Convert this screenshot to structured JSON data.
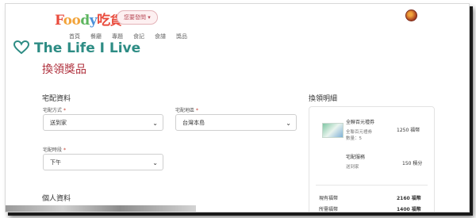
{
  "header": {
    "logo": {
      "letters": [
        "F",
        "oo",
        "d",
        "y",
        "吃",
        "貨"
      ]
    },
    "region_pill": "您要發問 ▾"
  },
  "nav": [
    "首頁",
    "餐廳",
    "專題",
    "食記",
    "食譜",
    "獎品"
  ],
  "overlay": {
    "blog_title": "The Life I Live"
  },
  "page": {
    "title": "換領獎品"
  },
  "delivery": {
    "section_title": "宅配資料",
    "method": {
      "label": "宅配方式",
      "value": "送到家"
    },
    "area": {
      "label": "宅配地區",
      "value": "台灣本島"
    },
    "time": {
      "label": "宅配時段",
      "value": "下午"
    },
    "required_mark": "*"
  },
  "personal": {
    "section_title": "個人資料"
  },
  "summary": {
    "title": "換領明細",
    "item": {
      "name": "全聯百元禮券",
      "desc": "全聯百元禮券",
      "qty": "數量：5",
      "points": "1250 福幣"
    },
    "shipping": {
      "name": "宅配服務",
      "desc": "送到家",
      "points": "150 積分"
    },
    "balance": {
      "label": "現有福幣",
      "value": "2160 福幣"
    },
    "needed": {
      "label": "所需福幣",
      "value": "1400 福幣"
    }
  },
  "colors": {
    "accent": "#b0333f",
    "overlay_text": "#2d8c84"
  }
}
